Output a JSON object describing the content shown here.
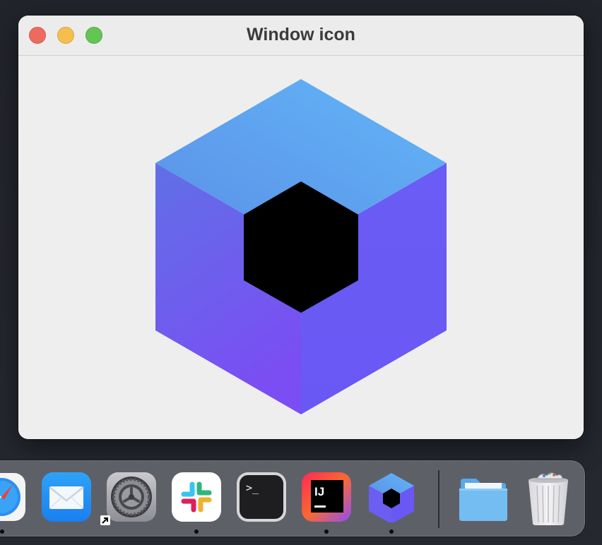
{
  "window": {
    "title": "Window icon",
    "traffic_lights": {
      "close_color": "#ee6a5f",
      "minimize_color": "#f5be4f",
      "zoom_color": "#62c554"
    }
  },
  "app_icon": {
    "name": "cube-logo-icon",
    "top_face_colors": [
      "#5b8fe6",
      "#62b6f8"
    ],
    "side_colors": [
      "#6160e8",
      "#7a4ef3"
    ],
    "center_color": "#000000"
  },
  "dock": {
    "items": [
      {
        "name": "safari-icon",
        "running": true
      },
      {
        "name": "mail-icon",
        "running": false
      },
      {
        "name": "system-preferences-icon",
        "running": false,
        "alias": true
      },
      {
        "name": "slack-icon",
        "running": true
      },
      {
        "name": "terminal-icon",
        "running": false,
        "label": ">_"
      },
      {
        "name": "intellij-idea-icon",
        "running": true,
        "label": "IJ"
      },
      {
        "name": "cube-app-icon",
        "running": true
      },
      {
        "name": "downloads-folder-icon",
        "running": false
      },
      {
        "name": "trash-icon",
        "running": false
      }
    ]
  }
}
